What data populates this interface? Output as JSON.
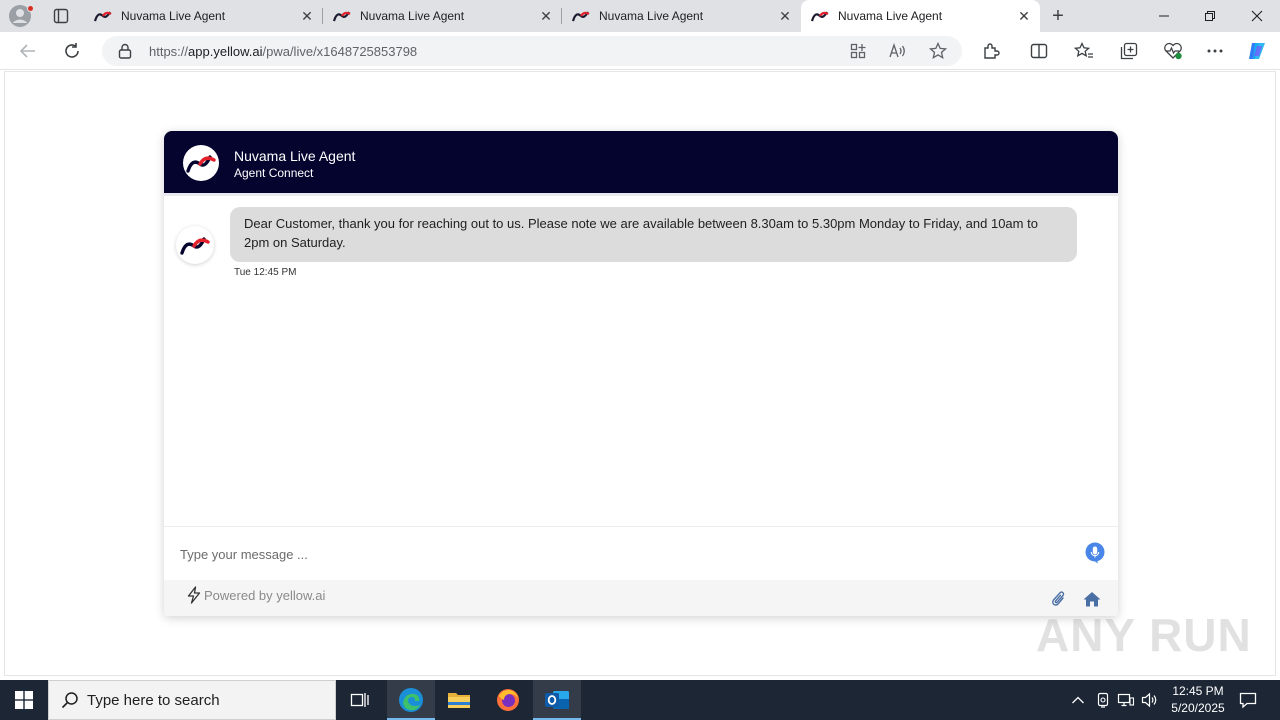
{
  "browser": {
    "tabs": [
      {
        "title": "Nuvama Live Agent",
        "active": false
      },
      {
        "title": "Nuvama Live Agent",
        "active": false
      },
      {
        "title": "Nuvama Live Agent",
        "active": false
      },
      {
        "title": "Nuvama Live Agent",
        "active": true
      }
    ],
    "url_scheme": "https://",
    "url_host": "app.yellow.ai",
    "url_path": "/pwa/live/x1648725853798"
  },
  "chat": {
    "title": "Nuvama Live Agent",
    "subtitle": "Agent Connect",
    "messages": [
      {
        "text": "Dear Customer, thank you for reaching out to us. Please note we are available between 8.30am to 5.30pm Monday to Friday, and 10am to 2pm on Saturday.",
        "time": "Tue 12:45 PM"
      }
    ],
    "input_placeholder": "Type your message ...",
    "powered_by": "Powered by yellow.ai"
  },
  "watermark": "ANY RUN",
  "taskbar": {
    "search_placeholder": "Type here to search",
    "clock_time": "12:45 PM",
    "clock_date": "5/20/2025"
  },
  "colors": {
    "chat_header": "#04042e",
    "bubble": "#dcdcdc",
    "brand_red": "#e3212d",
    "taskbar": "#1c2634"
  }
}
